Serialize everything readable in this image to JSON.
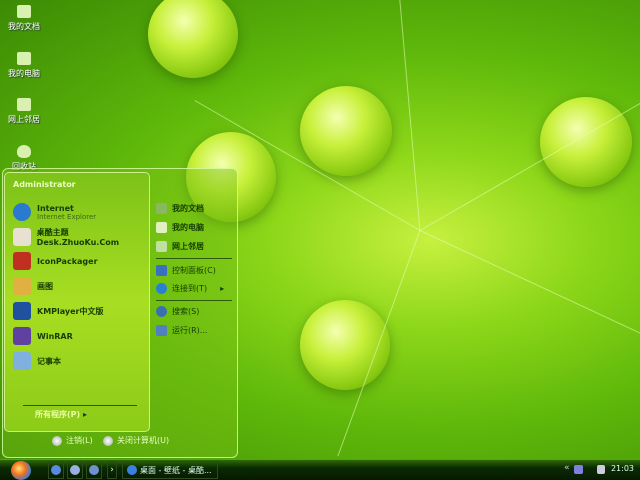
{
  "desktop": {
    "icons": [
      {
        "label": "我的文档"
      },
      {
        "label": "我的电脑"
      },
      {
        "label": "网上邻居"
      },
      {
        "label": "回收站"
      }
    ]
  },
  "start_menu": {
    "user": "Administrator",
    "programs": [
      {
        "label": "Internet",
        "sub": "Internet Explorer",
        "icon": "ie-icon",
        "color": "#2a7ad0"
      },
      {
        "label": "桌酷主题Desk.ZhuoKu.Com",
        "icon": "theme-icon",
        "color": "#e8e0d0"
      },
      {
        "label": "IconPackager",
        "icon": "iconpackager-icon",
        "color": "#c03020"
      },
      {
        "label": "画图",
        "icon": "paint-icon",
        "color": "#e0b040"
      },
      {
        "label": "KMPlayer中文版",
        "icon": "kmplayer-icon",
        "color": "#2050a0"
      },
      {
        "label": "WinRAR",
        "icon": "winrar-icon",
        "color": "#6040a0"
      },
      {
        "label": "记事本",
        "icon": "notepad-icon",
        "color": "#80b0e0"
      }
    ],
    "all_programs": "所有程序(P)",
    "places": [
      {
        "label": "我的文档",
        "icon": "documents-icon",
        "color": "#8ab860"
      },
      {
        "label": "我的电脑",
        "icon": "computer-icon",
        "color": "#e0f0c0"
      },
      {
        "label": "网上邻居",
        "icon": "network-icon",
        "color": "#c0e0a0"
      },
      {
        "label": "控制面板(C)",
        "icon": "control-panel-icon",
        "color": "#3a70c0"
      },
      {
        "label": "连接到(T)",
        "icon": "connect-icon",
        "color": "#2a80d0"
      },
      {
        "label": "搜索(S)",
        "icon": "search-icon",
        "color": "#3a70b0"
      },
      {
        "label": "运行(R)...",
        "icon": "run-icon",
        "color": "#5080c0"
      }
    ],
    "log_off": "注销(L)",
    "shutdown": "关闭计算机(U)"
  },
  "taskbar": {
    "task": "桌面 - 壁纸 - 桌酷...",
    "clock": "21:03",
    "more": "›"
  }
}
